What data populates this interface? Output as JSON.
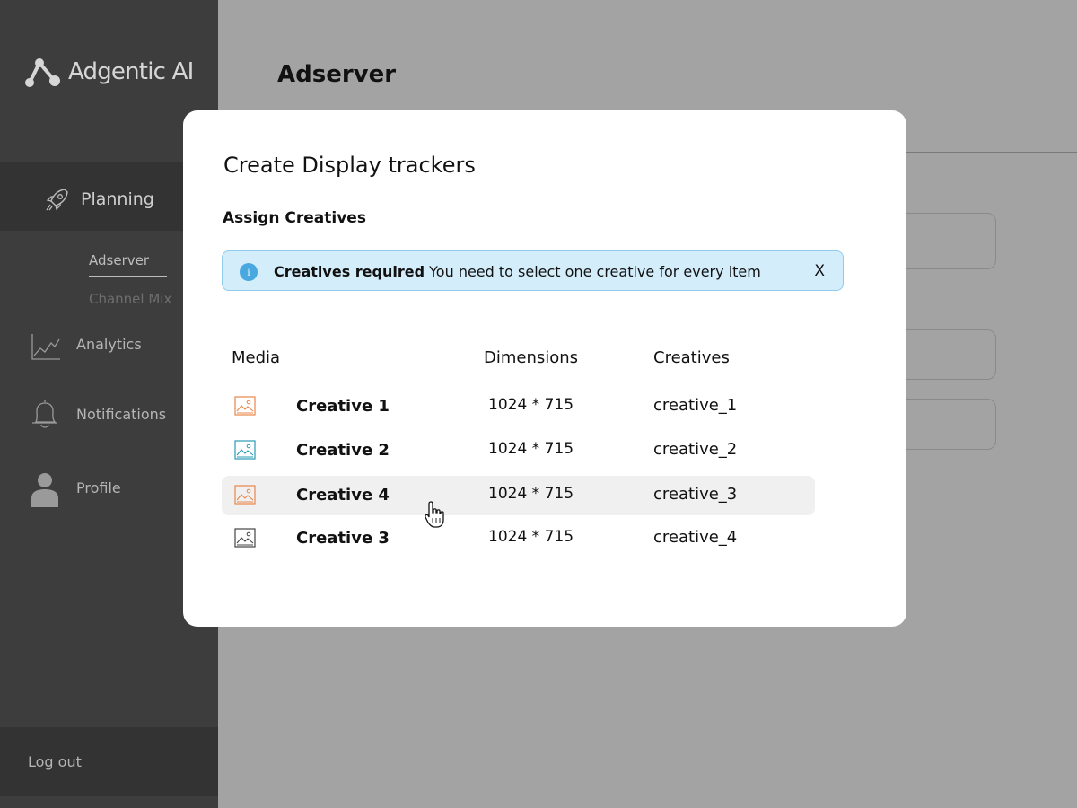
{
  "app": {
    "logo_text": "Adgentic AI"
  },
  "sidebar": {
    "planning_label": "Planning",
    "sub_items": [
      "Adserver",
      "Channel Mix"
    ],
    "items": [
      {
        "label": "Analytics",
        "icon": "chart-line-icon"
      },
      {
        "label": "Notifications",
        "icon": "bell-icon"
      },
      {
        "label": "Profile",
        "icon": "user-icon"
      }
    ],
    "logout_label": "Log out"
  },
  "page": {
    "title": "Adserver"
  },
  "modal": {
    "title": "Create Display trackers",
    "subtitle": "Assign Creatives",
    "alert": {
      "title": "Creatives required",
      "message": "You need to select one creative for every item",
      "close_label": "X",
      "icon": "info-icon"
    },
    "columns": [
      "Media",
      "Dimensions",
      "Creatives"
    ],
    "rows": [
      {
        "name": "Creative 1",
        "dimensions": "1024 * 715",
        "creative": "creative_1",
        "icon_color": "#e8874a"
      },
      {
        "name": "Creative 2",
        "dimensions": "1024 * 715",
        "creative": "creative_2",
        "icon_color": "#2a9bb5"
      },
      {
        "name": "Creative 4",
        "dimensions": "1024 * 715",
        "creative": "creative_3",
        "icon_color": "#e8874a"
      },
      {
        "name": "Creative 3",
        "dimensions": "1024 * 715",
        "creative": "creative_4",
        "icon_color": "#444444"
      }
    ]
  },
  "colors": {
    "sidebar_bg": "#3d3d3d",
    "overlay_bg": "#a3a3a3",
    "alert_bg": "#d4edfb",
    "info_accent": "#4aa8e0",
    "row_highlight": "#f0f0f0"
  }
}
